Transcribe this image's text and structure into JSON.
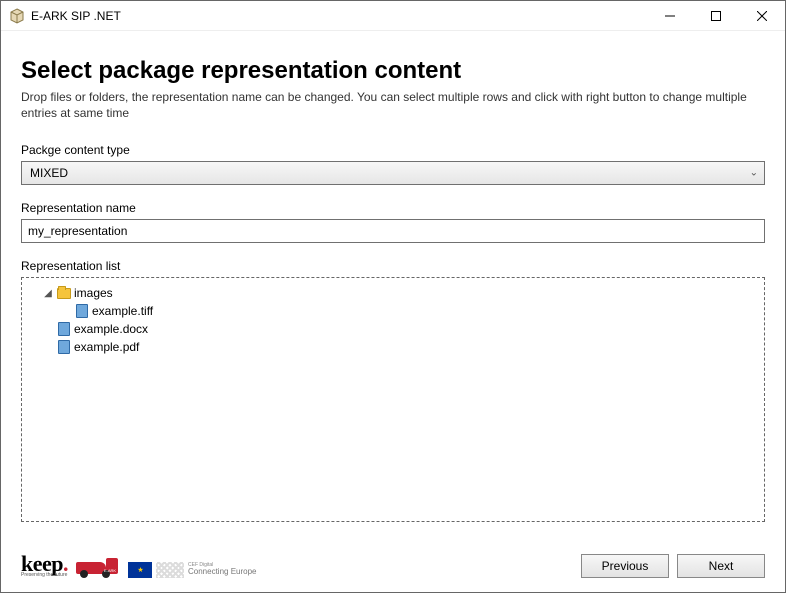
{
  "window": {
    "title": "E-ARK SIP .NET"
  },
  "page": {
    "heading": "Select package representation content",
    "subtitle": "Drop files or folders, the representation name can be changed. You can select multiple rows and click with right button to change multiple entries at same time"
  },
  "fields": {
    "content_type_label": "Packge content type",
    "content_type_value": "MIXED",
    "representation_name_label": "Representation name",
    "representation_name_value": "my_representation",
    "representation_list_label": "Representation list"
  },
  "tree": {
    "root": {
      "name": "images",
      "expanded": true,
      "children": [
        {
          "name": "example.tiff"
        }
      ]
    },
    "siblings": [
      {
        "name": "example.docx"
      },
      {
        "name": "example.pdf"
      }
    ]
  },
  "buttons": {
    "previous": "Previous",
    "next": "Next"
  },
  "footer": {
    "keep": "keep",
    "keep_sub": "Preserving the future",
    "eark": "E-ARK",
    "eu_small": "CEF Digital",
    "eu_main": "Connecting Europe"
  }
}
